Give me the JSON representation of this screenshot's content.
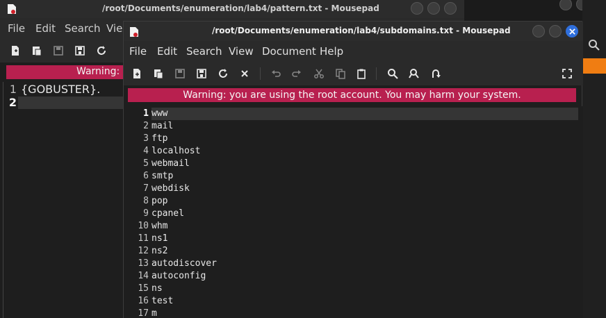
{
  "background_window": {
    "title": "/root/Documents/enumeration/lab4/pattern.txt - Mousepad",
    "menu": [
      "File",
      "Edit",
      "Search",
      "Vie"
    ],
    "warning": "Warning:",
    "lines": [
      {
        "num": "1",
        "text": "{GOBUSTER}."
      },
      {
        "num": "2",
        "text": ""
      }
    ]
  },
  "window": {
    "title": "/root/Documents/enumeration/lab4/subdomains.txt - Mousepad",
    "menu": [
      "File",
      "Edit",
      "Search",
      "View",
      "Document",
      "Help"
    ],
    "warning": "Warning: you are using the root account. You may harm your system.",
    "lines": [
      {
        "num": "1",
        "text": "www"
      },
      {
        "num": "2",
        "text": "mail"
      },
      {
        "num": "3",
        "text": "ftp"
      },
      {
        "num": "4",
        "text": "localhost"
      },
      {
        "num": "5",
        "text": "webmail"
      },
      {
        "num": "6",
        "text": "smtp"
      },
      {
        "num": "7",
        "text": "webdisk"
      },
      {
        "num": "8",
        "text": "pop"
      },
      {
        "num": "9",
        "text": "cpanel"
      },
      {
        "num": "10",
        "text": "whm"
      },
      {
        "num": "11",
        "text": "ns1"
      },
      {
        "num": "12",
        "text": "ns2"
      },
      {
        "num": "13",
        "text": "autodiscover"
      },
      {
        "num": "14",
        "text": "autoconfig"
      },
      {
        "num": "15",
        "text": "ns"
      },
      {
        "num": "16",
        "text": "test"
      },
      {
        "num": "17",
        "text": "m"
      }
    ]
  },
  "colors": {
    "warning_bg": "#b8204f",
    "close_button": "#2f6fdc",
    "desktop_accent": "#f07d12"
  }
}
